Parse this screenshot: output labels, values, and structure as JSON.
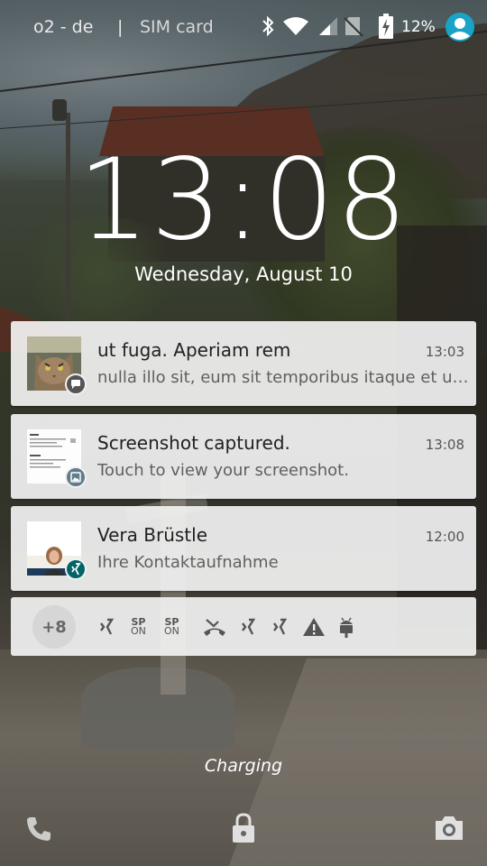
{
  "status_bar": {
    "carrier": "o2 - de",
    "separator": "|",
    "sim": "SIM card",
    "battery_percent": "12%",
    "icons": [
      "bluetooth-icon",
      "wifi-icon",
      "signal-icon",
      "no-sim-icon",
      "battery-charging-icon",
      "account-icon"
    ],
    "account_color": "#1aa3c7"
  },
  "lockscreen": {
    "time": "13:08",
    "date": "Wednesday, August 10",
    "charging_label": "Charging"
  },
  "notifications": [
    {
      "title": "ut fuga. Aperiam rem",
      "time": "13:03",
      "text": "nulla illo sit, eum sit temporibus itaque et ut ad vel",
      "thumb": "cat-photo",
      "badge_icon": "chat-bubble-icon",
      "badge_color": "#555555"
    },
    {
      "title": "Screenshot captured.",
      "time": "13:08",
      "text": "Touch to view your screenshot.",
      "thumb": "screenshot-preview",
      "badge_icon": "image-icon",
      "badge_color": "#607d8b"
    },
    {
      "title": "Vera Brüstle",
      "time": "12:00",
      "text": "Ihre Kontaktaufnahme",
      "thumb": "contact-photo",
      "badge_icon": "xing-icon",
      "badge_color": "#026466"
    }
  ],
  "overflow": {
    "more_count": "+8",
    "sp_label": "SP",
    "sp_sub": "ON",
    "icons": [
      "xing-icon",
      "sp-on-icon",
      "sp-on-icon",
      "missed-call-icon",
      "xing-icon",
      "xing-icon",
      "warning-icon",
      "android-icon"
    ]
  },
  "bottom_bar": [
    "phone-icon",
    "lock-icon",
    "camera-icon"
  ]
}
